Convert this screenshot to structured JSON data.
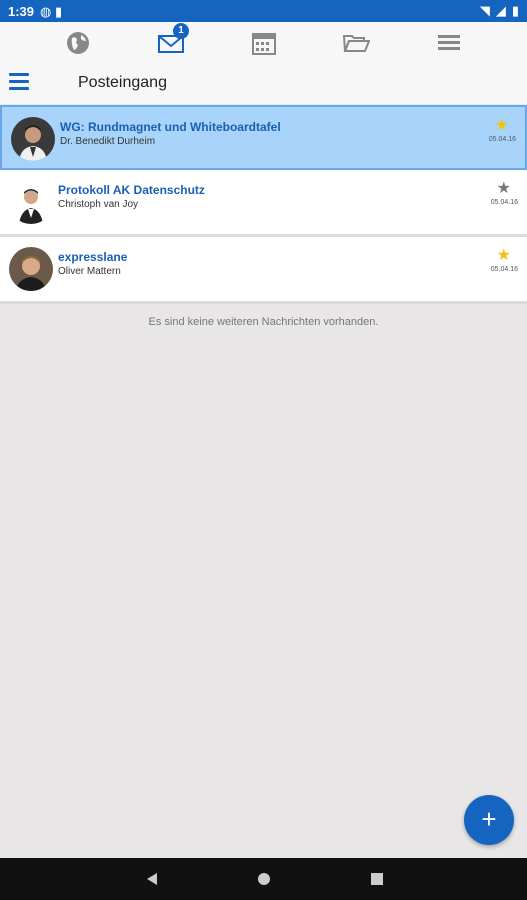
{
  "statusbar": {
    "time": "1:39"
  },
  "nav": {
    "badge_count": "1"
  },
  "header": {
    "title": "Posteingang"
  },
  "messages": [
    {
      "subject": "WG: Rundmagnet und Whiteboardtafel",
      "sender": "Dr. Benedikt Durheim",
      "date": "05.04.16",
      "starred": true
    },
    {
      "subject": "Protokoll AK Datenschutz",
      "sender": "Christoph van Joy",
      "date": "05.04.16",
      "starred": false
    },
    {
      "subject": "expresslane",
      "sender": "Oliver Mattern",
      "date": "05.04.16",
      "starred": true
    }
  ],
  "empty_note": "Es sind keine weiteren Nachrichten vorhanden.",
  "fab": {
    "label": "+"
  },
  "colors": {
    "primary": "#1565c0",
    "star_gold": "#f4c20d",
    "star_gray": "#777777",
    "selected_bg": "#a8d4fb"
  }
}
